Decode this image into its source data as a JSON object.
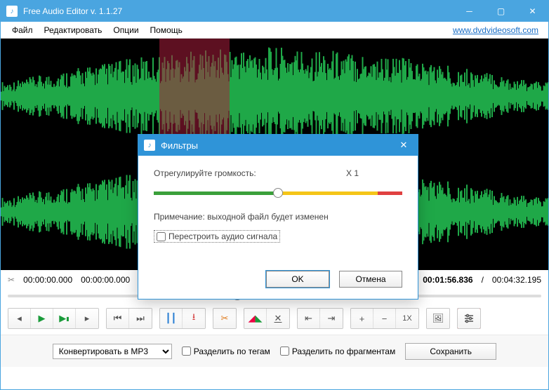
{
  "window": {
    "title": "Free Audio Editor v. 1.1.27",
    "link": "www.dvdvideosoft.com"
  },
  "menu": {
    "file": "Файл",
    "edit": "Редактировать",
    "options": "Опции",
    "help": "Помощь"
  },
  "time": {
    "sel_start": "00:00:00.000",
    "sel_end": "00:00:00.000",
    "current": "00:01:56.836",
    "total": "00:04:32.195",
    "separator": "/"
  },
  "toolbar": {
    "zoom_text": "1X"
  },
  "bottom": {
    "convert_label": "Конвертировать в MP3",
    "split_tags": "Разделить по тегам",
    "split_fragments": "Разделить по фрагментам",
    "save": "Сохранить"
  },
  "dialog": {
    "title": "Фильтры",
    "volume_label": "Отрегулируйте громкость:",
    "volume_value": "X 1",
    "note": "Примечание: выходной файл будет изменен",
    "rebuild": "Перестроить аудио сигнала",
    "ok": "OK",
    "cancel": "Отмена"
  }
}
